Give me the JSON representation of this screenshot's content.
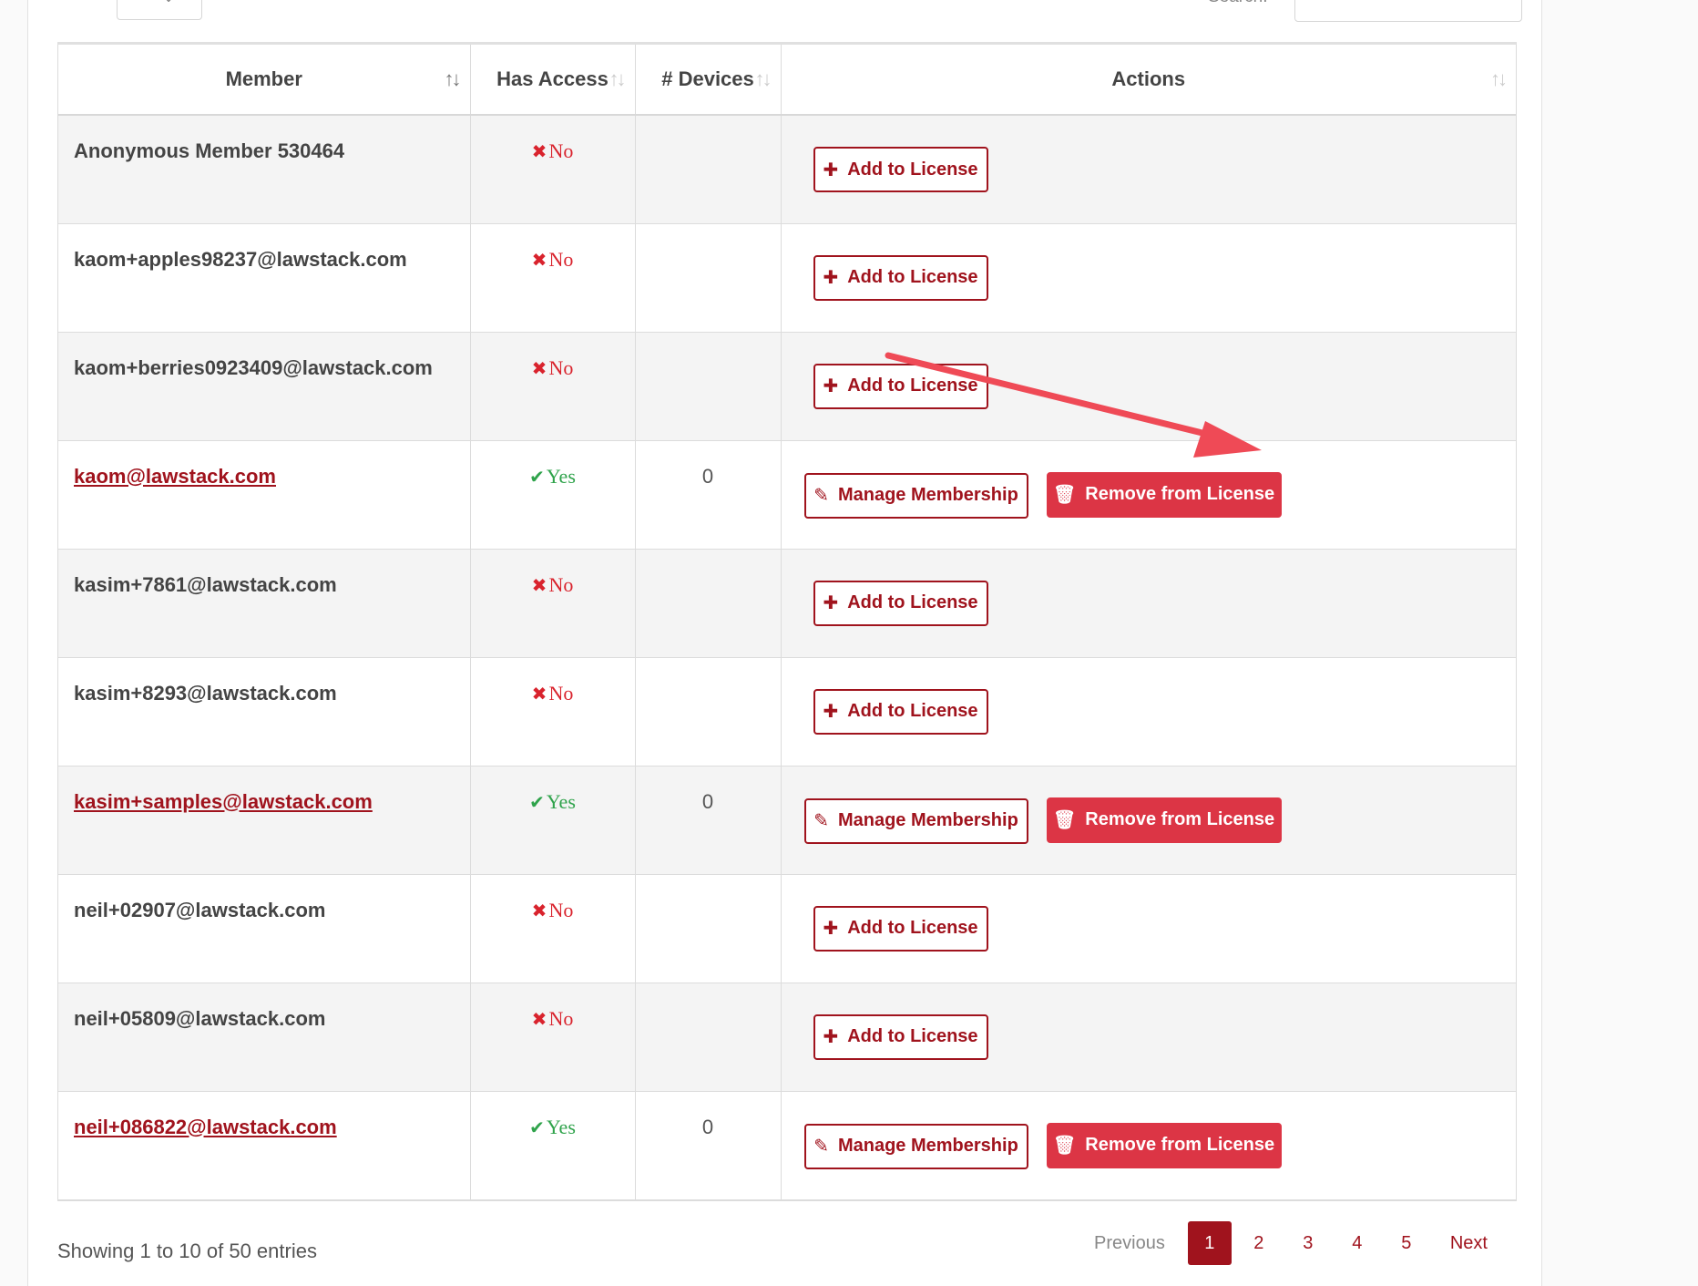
{
  "table": {
    "headers": [
      {
        "label": "Member"
      },
      {
        "label": "Has Access"
      },
      {
        "label": "# Devices"
      },
      {
        "label": "Actions"
      }
    ],
    "rows": [
      {
        "member": "Anonymous Member 530464",
        "access": "No",
        "devices": "",
        "actions": [
          "Add to License"
        ]
      },
      {
        "member": "kaom+apples98237@lawstack.com",
        "access": "No",
        "devices": "",
        "actions": [
          "Add to License"
        ]
      },
      {
        "member": "kaom+berries0923409@lawstack.com",
        "access": "No",
        "devices": "",
        "actions": [
          "Add to License"
        ]
      },
      {
        "member": "kaom@lawstack.com",
        "access": "Yes",
        "devices": "0",
        "actions": [
          "Manage Membership",
          "Remove from License"
        ]
      },
      {
        "member": "kasim+7861@lawstack.com",
        "access": "No",
        "devices": "",
        "actions": [
          "Add to License"
        ]
      },
      {
        "member": "kasim+8293@lawstack.com",
        "access": "No",
        "devices": "",
        "actions": [
          "Add to License"
        ]
      },
      {
        "member": "kasim+samples@lawstack.com",
        "access": "Yes",
        "devices": "0",
        "actions": [
          "Manage Membership",
          "Remove from License"
        ]
      },
      {
        "member": "neil+02907@lawstack.com",
        "access": "No",
        "devices": "",
        "actions": [
          "Add to License"
        ]
      },
      {
        "member": "neil+05809@lawstack.com",
        "access": "No",
        "devices": "",
        "actions": [
          "Add to License"
        ]
      },
      {
        "member": "neil+086822@lawstack.com",
        "access": "Yes",
        "devices": "0",
        "actions": [
          "Manage Membership",
          "Remove from License"
        ]
      }
    ]
  },
  "footer": {
    "info": "Showing 1 to 10 of 50 entries",
    "previous": "Previous",
    "pages": [
      "1",
      "2",
      "3",
      "4",
      "5"
    ],
    "next": "Next"
  },
  "controls": {
    "search_label": "Search:"
  },
  "colors": {
    "brand": "#a0131d",
    "danger": "#dc3545",
    "access_no": "#d9232d",
    "access_yes": "#2fa34b",
    "annotation_arrow": "#ef4a56"
  },
  "icons": {
    "sort": "sort-icon",
    "add": "plus-icon",
    "manage": "edit-icon",
    "remove": "trash-icon",
    "no": "cross-icon",
    "yes": "check-icon"
  }
}
